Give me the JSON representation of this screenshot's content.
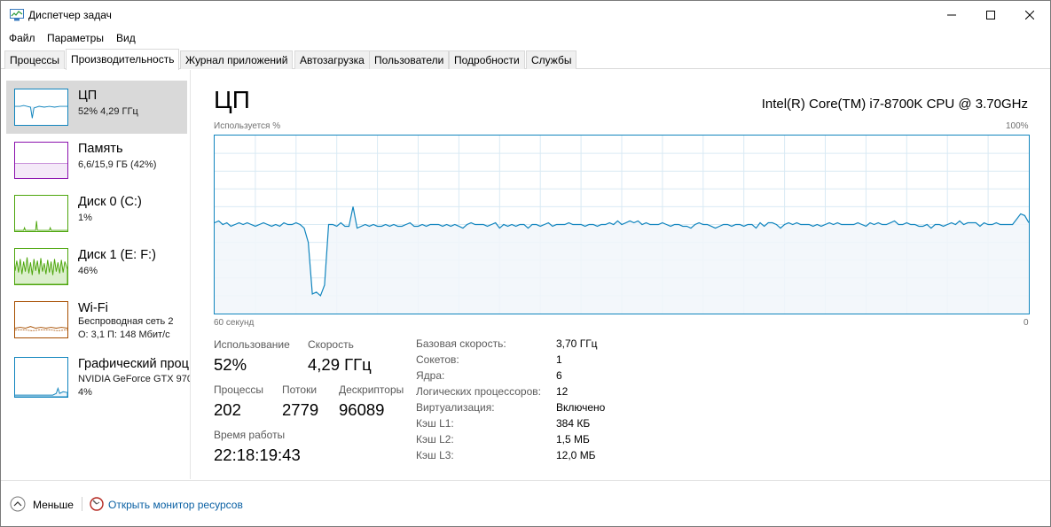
{
  "window": {
    "title": "Диспетчер задач"
  },
  "menu": [
    "Файл",
    "Параметры",
    "Вид"
  ],
  "tabs": [
    {
      "label": "Процессы"
    },
    {
      "label": "Производительность",
      "active": true
    },
    {
      "label": "Журнал приложений"
    },
    {
      "label": "Автозагрузка"
    },
    {
      "label": "Пользователи"
    },
    {
      "label": "Подробности"
    },
    {
      "label": "Службы"
    }
  ],
  "sidebar": [
    {
      "title": "ЦП",
      "sub1": "52% 4,29 ГГц",
      "sub2": "",
      "color": "#1185be",
      "icon": "cpu-mini-graph",
      "selected": true
    },
    {
      "title": "Память",
      "sub1": "6,6/15,9 ГБ (42%)",
      "sub2": "",
      "color": "#8b12ae",
      "icon": "memory-mini-graph"
    },
    {
      "title": "Диск 0 (C:)",
      "sub1": "1%",
      "sub2": "",
      "color": "#4da60c",
      "icon": "disk0-mini-graph"
    },
    {
      "title": "Диск 1 (E: F:)",
      "sub1": "46%",
      "sub2": "",
      "color": "#4da60c",
      "icon": "disk1-mini-graph"
    },
    {
      "title": "Wi-Fi",
      "sub1": "Беспроводная сеть 2",
      "sub2": "О: 3,1  П: 148 Мбит/с",
      "color": "#a74f01",
      "icon": "wifi-mini-graph"
    },
    {
      "title": "Графический проц",
      "sub1": "NVIDIA GeForce GTX 970",
      "sub2": "4%",
      "color": "#1185be",
      "icon": "gpu-mini-graph"
    }
  ],
  "main": {
    "title": "ЦП",
    "cpu_name": "Intel(R) Core(TM) i7-8700K CPU @ 3.70GHz",
    "axis_top_left": "Используется %",
    "axis_top_right": "100%",
    "axis_bottom_left": "60 секунд",
    "axis_bottom_right": "0",
    "graph_color": "#1185be",
    "graph_fill": "#f1f6fa",
    "utilization_history": [
      51,
      52,
      50,
      51,
      49,
      50,
      51,
      50,
      51,
      50,
      49,
      50,
      51,
      50,
      49,
      50,
      49,
      51,
      50,
      50,
      51,
      50,
      48,
      40,
      11,
      12,
      10,
      16,
      50,
      50,
      49,
      51,
      49,
      49,
      60,
      48,
      49,
      50,
      49,
      50,
      49,
      49,
      50,
      49,
      50,
      49,
      49,
      50,
      51,
      49,
      49,
      50,
      49,
      50,
      50,
      50,
      49,
      50,
      49,
      50,
      49,
      48,
      50,
      51,
      50,
      50,
      50,
      49,
      50,
      51,
      48,
      50,
      49,
      50,
      49,
      50,
      50,
      48,
      50,
      50,
      49,
      50,
      51,
      49,
      50,
      50,
      50,
      51,
      50,
      50,
      50,
      49,
      50,
      50,
      49,
      50,
      50,
      51,
      50,
      52,
      50,
      51,
      52,
      51,
      52,
      50,
      51,
      50,
      50,
      50,
      51,
      50,
      49,
      50,
      50,
      49,
      49,
      48,
      50,
      51,
      50,
      50,
      49,
      48,
      49,
      50,
      50,
      49,
      50,
      50,
      49,
      50,
      50,
      48,
      51,
      49,
      51,
      51,
      50,
      48,
      50,
      51,
      50,
      51,
      50,
      50,
      50,
      49,
      50,
      49,
      50,
      51,
      50,
      51,
      50,
      50,
      50,
      50,
      51,
      50,
      49,
      51,
      50,
      51,
      50,
      50,
      51,
      52,
      50,
      50,
      51,
      50,
      50,
      49,
      49,
      50,
      48,
      50,
      50,
      49,
      50,
      51,
      50,
      52,
      50,
      51,
      51,
      51,
      49,
      51,
      50,
      50,
      51,
      50,
      50,
      50,
      50,
      53,
      56,
      55,
      51
    ],
    "stats": {
      "util_label": "Использование",
      "util_value": "52%",
      "speed_label": "Скорость",
      "speed_value": "4,29 ГГц",
      "proc_label": "Процессы",
      "proc_value": "202",
      "threads_label": "Потоки",
      "threads_value": "2779",
      "handles_label": "Дескрипторы",
      "handles_value": "96089",
      "uptime_label": "Время работы",
      "uptime_value": "22:18:19:43"
    },
    "specs": [
      {
        "label": "Базовая скорость:",
        "value": "3,70 ГГц"
      },
      {
        "label": "Сокетов:",
        "value": "1"
      },
      {
        "label": "Ядра:",
        "value": "6"
      },
      {
        "label": "Логических процессоров:",
        "value": "12"
      },
      {
        "label": "Виртуализация:",
        "value": "Включено"
      },
      {
        "label": "Кэш L1:",
        "value": "384 КБ"
      },
      {
        "label": "Кэш L2:",
        "value": "1,5 МБ"
      },
      {
        "label": "Кэш L3:",
        "value": "12,0 МБ"
      }
    ]
  },
  "footer": {
    "less_label": "Меньше",
    "monitor_link": "Открыть монитор ресурсов"
  }
}
